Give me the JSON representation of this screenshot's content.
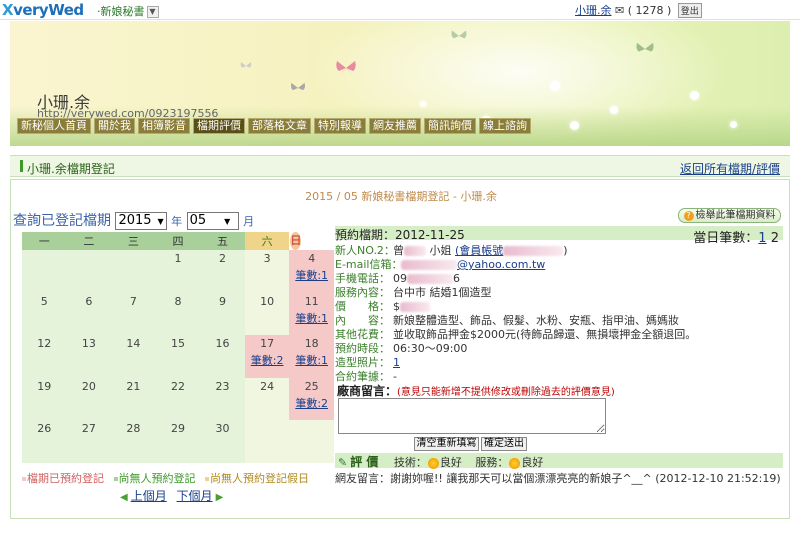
{
  "topbar": {
    "logo_prefix": "X",
    "logo_text": "veryWed",
    "brand": "·新娘秘書",
    "brand_dd": "▼",
    "user_name": "小珊.余",
    "mail_count": "( 1278 )",
    "logout": "登出"
  },
  "banner": {
    "shop_name": "小珊.余",
    "url": "http://verywed.com/0923197556"
  },
  "nav": [
    {
      "label": "新秘個人首頁"
    },
    {
      "label": "關於我"
    },
    {
      "label": "相簿影音"
    },
    {
      "label": "檔期評價"
    },
    {
      "label": "部落格文章"
    },
    {
      "label": "特別報導"
    },
    {
      "label": "網友推薦"
    },
    {
      "label": "簡訊詢價"
    },
    {
      "label": "線上諮詢"
    }
  ],
  "subhdr": {
    "title": "小珊.余檔期登記",
    "back": "返回所有檔期/評價"
  },
  "calendar": {
    "title": "2015 / 05 新娘秘書檔期登記 - 小珊.余",
    "query_label": "查詢已登記檔期",
    "year": "2015",
    "year_suffix": "年",
    "month": "05",
    "month_suffix": "月",
    "weekdays": [
      "一",
      "二",
      "三",
      "四",
      "五",
      "六",
      "日"
    ],
    "weeks": [
      [
        "",
        "",
        "",
        "1",
        "2",
        "3",
        "4"
      ],
      [
        "5",
        "6",
        "7",
        "8",
        "9",
        "10",
        "11"
      ],
      [
        "12",
        "13",
        "14",
        "15",
        "16",
        "17",
        "18"
      ],
      [
        "19",
        "20",
        "21",
        "22",
        "23",
        "24",
        "25"
      ],
      [
        "26",
        "27",
        "28",
        "29",
        "30",
        "",
        ""
      ]
    ],
    "booking_prefix": "筆數:",
    "bookings": {
      "4": "1",
      "11": "1",
      "17": "2",
      "18": "1",
      "25": "2"
    },
    "legend": {
      "booked": "檔期已預約登記",
      "free": "尚無人預約登記",
      "free_holiday": "尚無人預約登記假日"
    },
    "prev": "上個月",
    "next": "下個月"
  },
  "detail": {
    "view_button": "檢舉此筆檔期資料",
    "date_label": "預約檔期：",
    "date": "2012-11-25",
    "day_count_label": "當日筆數：",
    "day_count_links": [
      "1",
      "2"
    ],
    "bride_label": "新人NO.2：",
    "bride_name": "曾",
    "bride_title": "小姐",
    "member_link": "(會員帳號",
    "email_label": "E-mail信箱：",
    "email": "@yahoo.com.tw",
    "phone_label": "手機電話：",
    "phone": "09",
    "phone_tail": "6",
    "service_label": "服務內容：",
    "service": "台中市 結婚1個造型",
    "price_label": "價　　格：",
    "price": "$",
    "content_label": "內　　容：",
    "content": "新娘整體造型、飾品、假髮、水粉、安瓶、指甲油、媽媽妝",
    "extra_label": "其他花費：",
    "extra": "並收取飾品押金$2000元(待飾品歸還、無損壞押金全額退回。",
    "time_label": "預約時段：",
    "time": "06:30～09:00",
    "photo_label": "造型照片：",
    "photo": "1",
    "contract_label": "合約筆據：",
    "contract": "-",
    "comment_label": "廠商留言：",
    "comment_note": "(意見只能新增不提供修改或刪除過去的評價意見)",
    "clear_btn": "清空重新填寫",
    "submit_btn": "確定送出",
    "eval_title": "評 價",
    "tech_label": "技術：",
    "tech_value": "良好",
    "service_eval_label": "服務：",
    "service_eval_value": "良好",
    "review": "網友留言：謝謝妳喔!! 讓我那天可以當個漂漂亮亮的新娘子^__^  (2012-12-10 21:52:19)"
  },
  "colors": {
    "accent_green": "#3d9a2a",
    "link_blue": "#1a3f8a",
    "booked_pink": "#f6c9c9",
    "weekday_header": "#a9d09a",
    "sat_header": "#f0d48a",
    "sun_header": "#f3c79a",
    "note_red": "#c00000"
  }
}
